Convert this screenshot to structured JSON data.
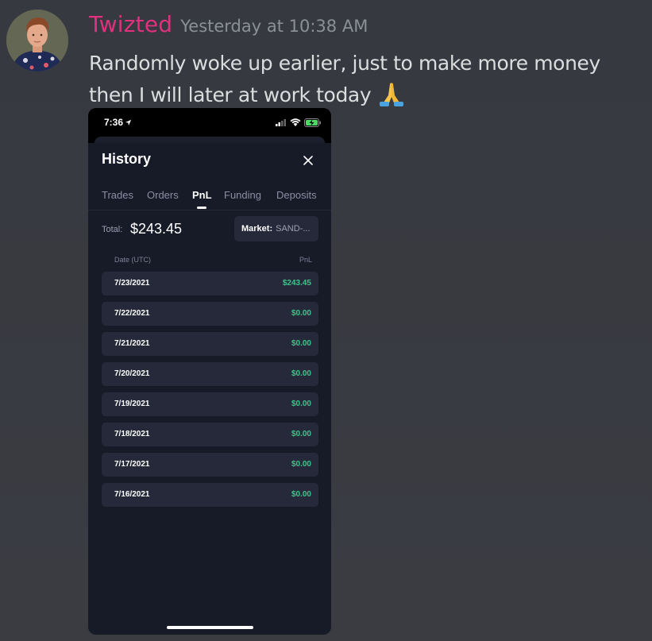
{
  "message": {
    "username": "Twizted",
    "timestamp": "Yesterday at 10:38 AM",
    "text": "Randomly woke up earlier, just to make more money then I will later at work today",
    "emoji": "folded-hands-emoji",
    "username_color": "#e0317f"
  },
  "phone": {
    "status_bar": {
      "time": "7:36"
    },
    "title": "History",
    "tabs": [
      {
        "label": "Trades",
        "active": false
      },
      {
        "label": "Orders",
        "active": false
      },
      {
        "label": "PnL",
        "active": true
      },
      {
        "label": "Funding",
        "active": false
      },
      {
        "label": "Deposits",
        "active": false
      }
    ],
    "total_label": "Total:",
    "total_value": "$243.45",
    "market_label": "Market:",
    "market_value": "SAND-...",
    "columns": {
      "date": "Date (UTC)",
      "pnl": "PnL"
    },
    "rows": [
      {
        "date": "7/23/2021",
        "pnl": "$243.45"
      },
      {
        "date": "7/22/2021",
        "pnl": "$0.00"
      },
      {
        "date": "7/21/2021",
        "pnl": "$0.00"
      },
      {
        "date": "7/20/2021",
        "pnl": "$0.00"
      },
      {
        "date": "7/19/2021",
        "pnl": "$0.00"
      },
      {
        "date": "7/18/2021",
        "pnl": "$0.00"
      },
      {
        "date": "7/17/2021",
        "pnl": "$0.00"
      },
      {
        "date": "7/16/2021",
        "pnl": "$0.00"
      }
    ],
    "pnl_color": "#3ec38a"
  }
}
